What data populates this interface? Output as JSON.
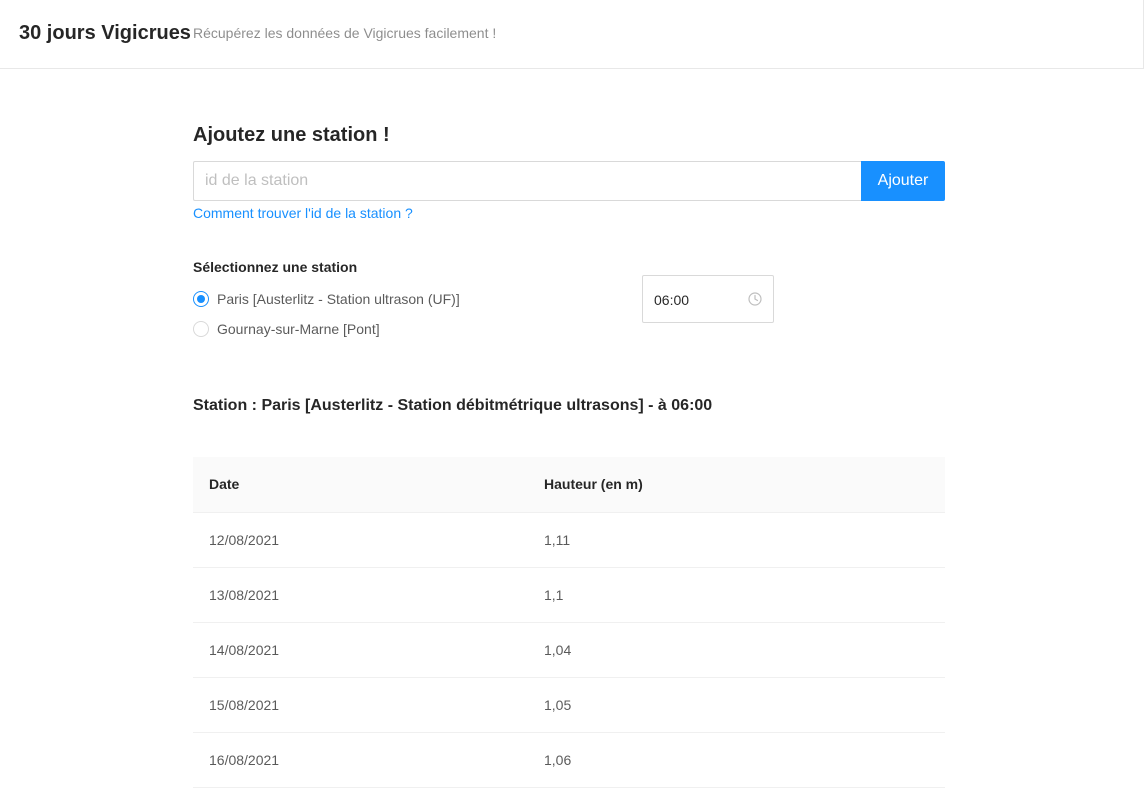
{
  "header": {
    "title": "30 jours Vigicrues",
    "subtitle": "Récupérez les données de Vigicrues facilement !"
  },
  "add_station": {
    "title": "Ajoutez une station !",
    "input_placeholder": "id de la station",
    "input_value": "",
    "button_label": "Ajouter",
    "help_link": "Comment trouver l'id de la station ?"
  },
  "select_station": {
    "label": "Sélectionnez une station",
    "options": [
      {
        "label": "Paris [Austerlitz - Station ultrason (UF)]",
        "checked": true
      },
      {
        "label": "Gournay-sur-Marne [Pont]",
        "checked": false
      }
    ]
  },
  "time_picker": {
    "value": "06:00",
    "icon": "clock-icon"
  },
  "station_heading": "Station : Paris [Austerlitz - Station débitmétrique ultrasons] - à 06:00",
  "table": {
    "columns": [
      "Date",
      "Hauteur (en m)"
    ],
    "rows": [
      [
        "12/08/2021",
        "1,11"
      ],
      [
        "13/08/2021",
        "1,1"
      ],
      [
        "14/08/2021",
        "1,04"
      ],
      [
        "15/08/2021",
        "1,05"
      ],
      [
        "16/08/2021",
        "1,06"
      ]
    ]
  },
  "colors": {
    "accent": "#1890ff",
    "border": "#d9d9d9",
    "table_header_bg": "#fafafa"
  }
}
